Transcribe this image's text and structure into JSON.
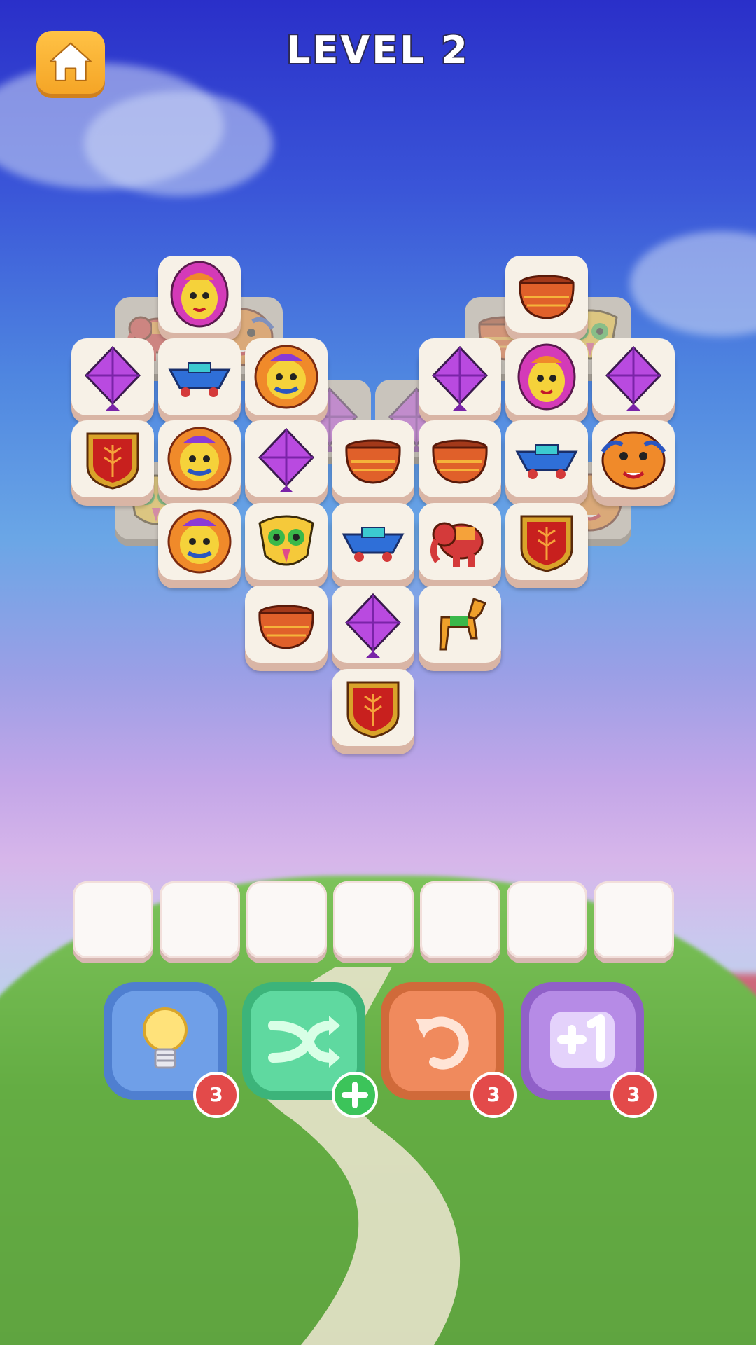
{
  "header": {
    "level_title": "LEVEL 2",
    "home_icon": "home-icon"
  },
  "board": {
    "tiles_front": [
      {
        "icon": "queen-mask-icon"
      },
      {
        "icon": "clay-pot-icon"
      },
      {
        "icon": "kite-icon"
      },
      {
        "icon": "toy-boat-icon"
      },
      {
        "icon": "king-mask-icon"
      },
      {
        "icon": "kite-icon"
      },
      {
        "icon": "queen-mask-icon"
      },
      {
        "icon": "kite-icon"
      },
      {
        "icon": "fan-flag-icon"
      },
      {
        "icon": "king-mask-icon"
      },
      {
        "icon": "kite-icon"
      },
      {
        "icon": "clay-pot-icon"
      },
      {
        "icon": "clay-pot-icon"
      },
      {
        "icon": "toy-boat-icon"
      },
      {
        "icon": "tiger-mask-icon"
      },
      {
        "icon": "king-mask-icon"
      },
      {
        "icon": "owl-mask-icon"
      },
      {
        "icon": "toy-boat-icon"
      },
      {
        "icon": "elephant-toy-icon"
      },
      {
        "icon": "fan-flag-icon"
      },
      {
        "icon": "clay-pot-icon"
      },
      {
        "icon": "kite-icon"
      },
      {
        "icon": "horse-toy-icon"
      },
      {
        "icon": "fan-flag-icon"
      }
    ],
    "tiles_back": [
      {
        "icon": "elephant-toy-icon"
      },
      {
        "icon": "tiger-mask-icon"
      },
      {
        "icon": "clay-pot-icon"
      },
      {
        "icon": "owl-mask-icon"
      },
      {
        "icon": "kite-icon"
      },
      {
        "icon": "kite-icon"
      },
      {
        "icon": "owl-mask-icon"
      },
      {
        "icon": "tiger-mask-icon"
      }
    ]
  },
  "tray": {
    "slots": 7
  },
  "powerups": [
    {
      "name": "hint",
      "icon": "lightbulb-icon",
      "count": "3",
      "color": "#6f9fe8"
    },
    {
      "name": "shuffle",
      "icon": "shuffle-icon",
      "count": "",
      "color": "#5fd9a0"
    },
    {
      "name": "undo",
      "icon": "undo-icon",
      "count": "3",
      "color": "#f08a5d"
    },
    {
      "name": "extra-slot",
      "icon": "plus-one-icon",
      "count": "3",
      "color": "#b68be6"
    }
  ],
  "colors": {
    "accent": "#f5a526",
    "badge": "#e34a4a",
    "plus_badge": "#3cc45a"
  }
}
